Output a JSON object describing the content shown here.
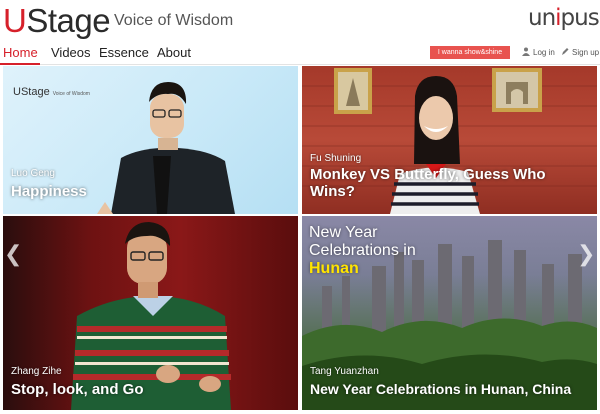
{
  "header": {
    "logo_u": "U",
    "logo_rest": "Stage",
    "tagline": "Voice of Wisdom",
    "brand_a": "un",
    "brand_dot": "i",
    "brand_b": "pus"
  },
  "nav": {
    "items": [
      {
        "label": "Home",
        "active": true
      },
      {
        "label": "Videos"
      },
      {
        "label": "Essence"
      },
      {
        "label": "About"
      }
    ],
    "cta": "I wanna show&shine",
    "login": "Log in",
    "signup": "Sign up"
  },
  "tiles": [
    {
      "name": "Luo Geng",
      "title": "Happiness",
      "overlay_logo": "UStage",
      "overlay_tag": "Voice of Wisdom"
    },
    {
      "name": "Fu Shuning",
      "title_line1": "Monkey VS Butterfly, Guess Who",
      "title_line2": "Wins?"
    },
    {
      "name": "Zhang Zihe",
      "title": "Stop, look, and Go"
    },
    {
      "name": "Tang Yuanzhan",
      "title": "New Year Celebrations in Hunan, China",
      "overlay_line1": "New Year",
      "overlay_line2": "Celebrations in",
      "overlay_line3": "Hunan"
    }
  ],
  "carousel": {
    "prev": "❮",
    "next": "❯"
  },
  "colors": {
    "accent": "#d6202a",
    "cta": "#e8534f"
  }
}
